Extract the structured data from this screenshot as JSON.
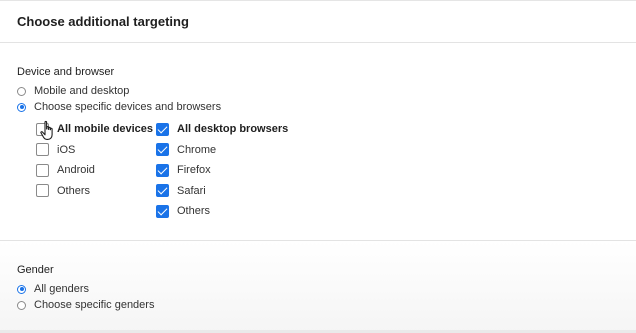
{
  "header": {
    "title": "Choose additional targeting"
  },
  "device": {
    "label": "Device and browser",
    "options": [
      {
        "label": "Mobile and desktop",
        "selected": false
      },
      {
        "label": "Choose specific devices and browsers",
        "selected": true
      }
    ],
    "mobile": {
      "all_label": "All mobile devices",
      "items": [
        {
          "label": "iOS",
          "checked": false
        },
        {
          "label": "Android",
          "checked": false
        },
        {
          "label": "Others",
          "checked": false
        }
      ],
      "all_checked": false
    },
    "desktop": {
      "all_label": "All desktop browsers",
      "items": [
        {
          "label": "Chrome",
          "checked": true
        },
        {
          "label": "Firefox",
          "checked": true
        },
        {
          "label": "Safari",
          "checked": true
        },
        {
          "label": "Others",
          "checked": true
        }
      ],
      "all_checked": true
    }
  },
  "gender": {
    "label": "Gender",
    "options": [
      {
        "label": "All genders",
        "selected": true
      },
      {
        "label": "Choose specific genders",
        "selected": false
      }
    ]
  },
  "colors": {
    "accent": "#1a73e8",
    "border": "#8a8a8a"
  },
  "icons": {
    "cursor": "hand-pointer-icon"
  }
}
